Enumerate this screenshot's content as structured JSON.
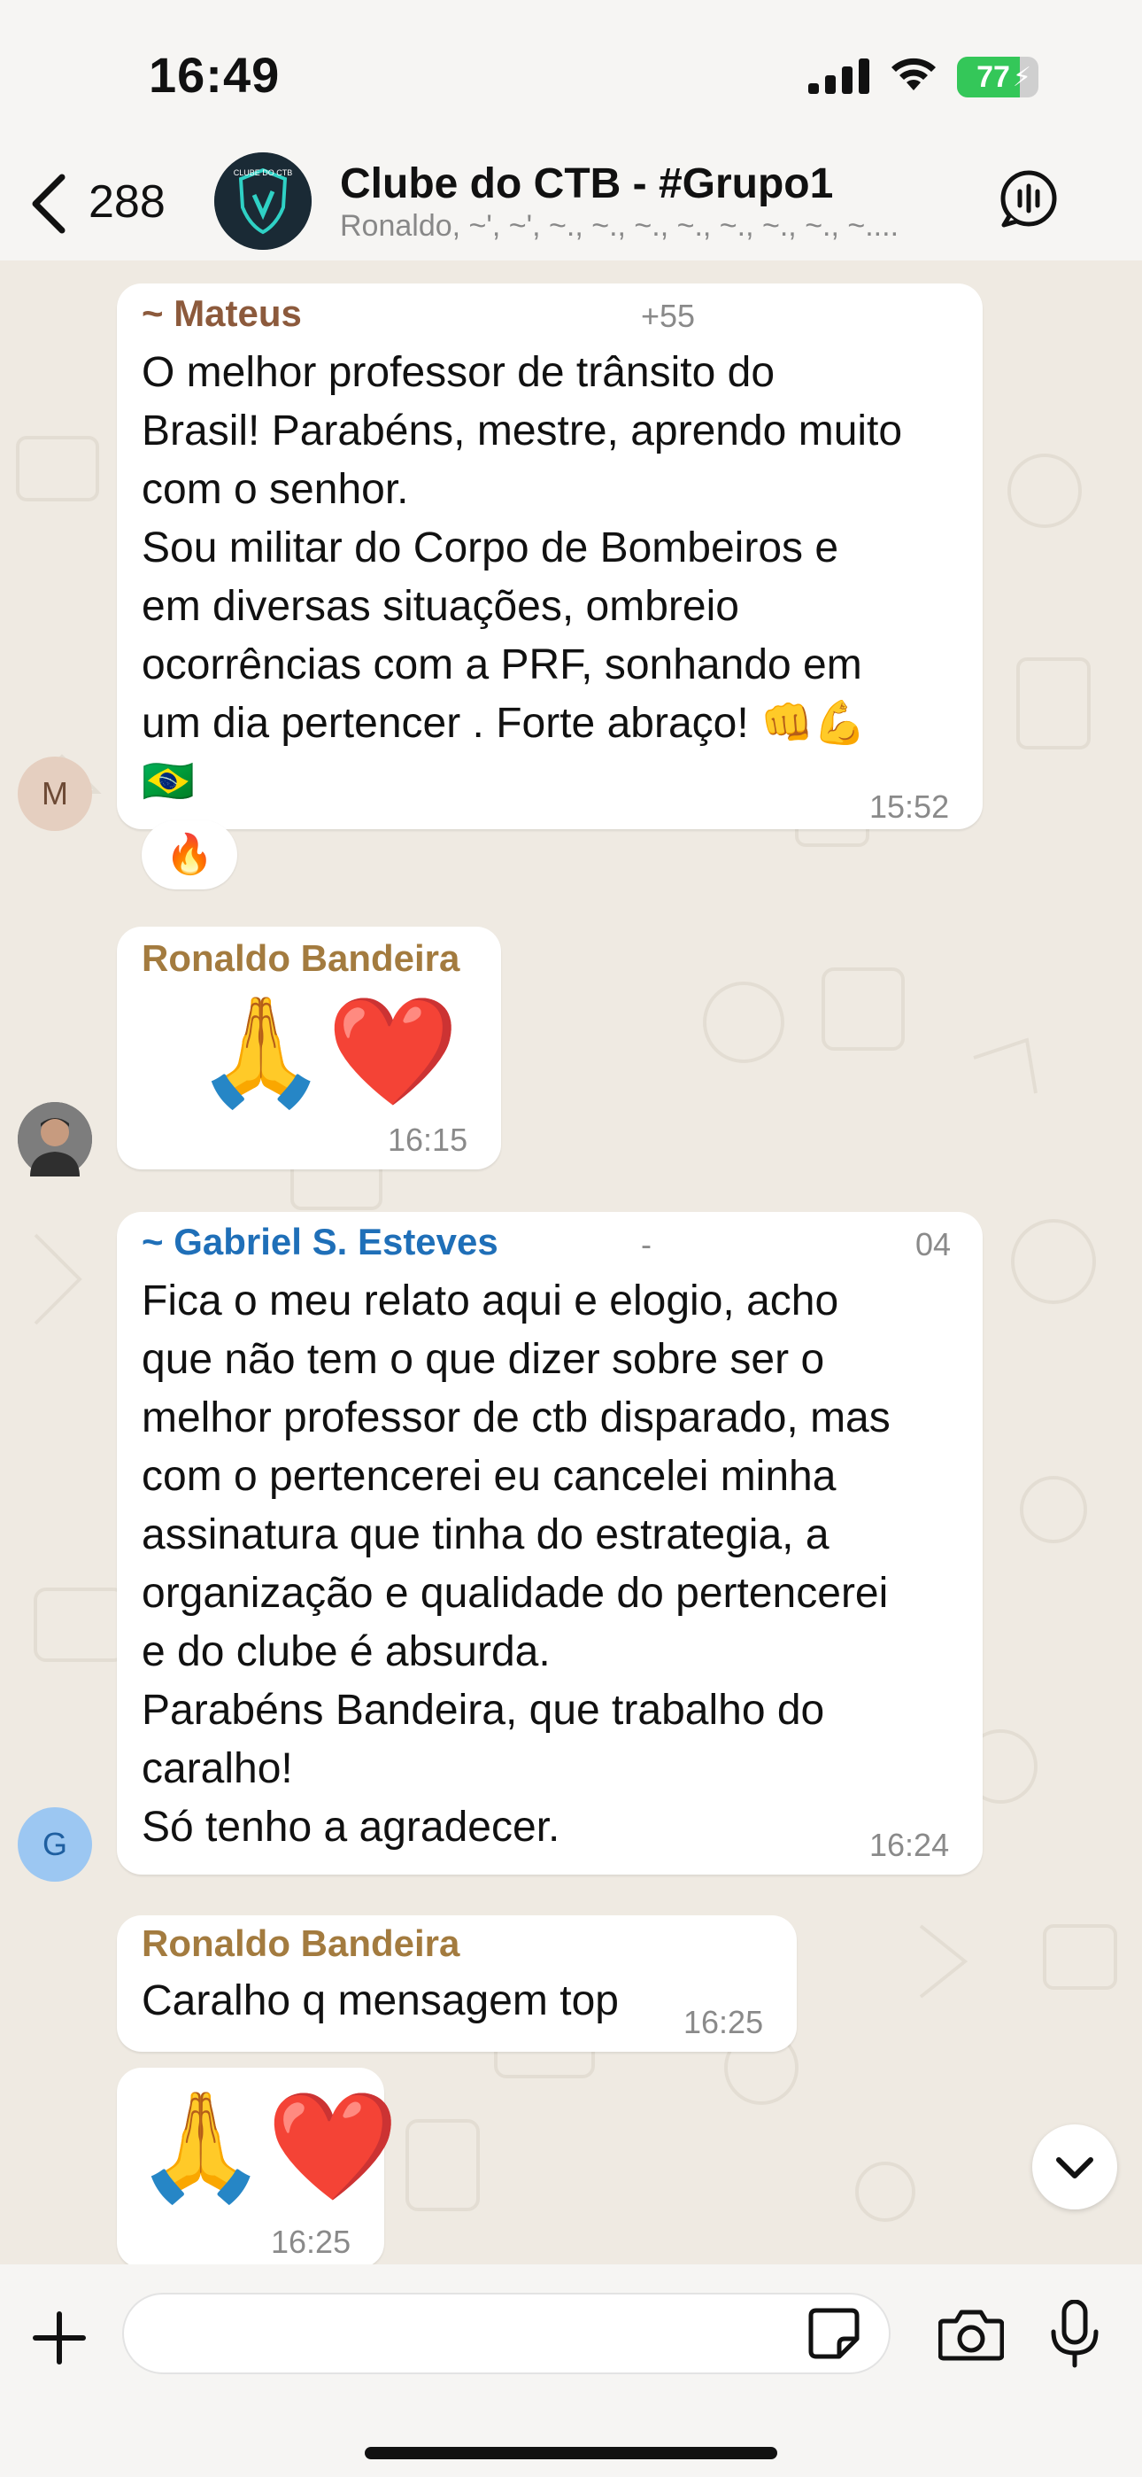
{
  "status_bar": {
    "time": "16:49",
    "battery_percent": 77,
    "battery_label": "77"
  },
  "header": {
    "back_count": "288",
    "title": "Clube do CTB - #Grupo1",
    "members": "Ronaldo, ~', ~', ~., ~., ~., ~., ~., ~., ~., ~....",
    "avatar_text": "CLUBE DO CTB"
  },
  "messages": [
    {
      "sender": "~ Mateus",
      "phone": "+55",
      "text": "O melhor professor de trânsito do\nBrasil! Parabéns, mestre, aprendo muito\ncom o senhor.\nSou militar do Corpo de Bombeiros e\nem  diversas situações, ombreio\nocorrências com a PRF, sonhando em\num dia pertencer . Forte abraço! 👊💪\n🇧🇷",
      "time": "15:52",
      "avatar_letter": "M",
      "reaction": "🔥"
    },
    {
      "sender": "Ronaldo Bandeira",
      "emoji": "🙏❤️",
      "time": "16:15"
    },
    {
      "sender": "~ Gabriel S. Esteves",
      "phone_dash": "-",
      "phone": "04",
      "text": "Fica o meu relato aqui e elogio, acho\nque não tem o que dizer sobre ser o\nmelhor professor de ctb disparado, mas\ncom o pertencerei eu cancelei minha\nassinatura que tinha do estrategia, a\norganização e qualidade do pertencerei\ne do clube é absurda.\nParabéns Bandeira, que trabalho do\ncaralho!\nSó tenho a agradecer.",
      "time": "16:24",
      "avatar_letter": "G"
    },
    {
      "sender": "Ronaldo Bandeira",
      "text": "Caralho q mensagem top",
      "time": "16:25"
    },
    {
      "emoji": "🙏❤️",
      "time": "16:25"
    }
  ],
  "input": {
    "value": "",
    "placeholder": ""
  },
  "colors": {
    "mateus": "#8c5a3c",
    "ronaldo": "#a37b3f",
    "gabriel": "#1f6fb8",
    "chat_bg": "#efeae2",
    "battery": "#34c759"
  },
  "icons": [
    "chevron-left-icon",
    "call-waveform-icon",
    "plus-icon",
    "sticker-icon",
    "camera-icon",
    "microphone-icon",
    "chevron-down-icon"
  ]
}
